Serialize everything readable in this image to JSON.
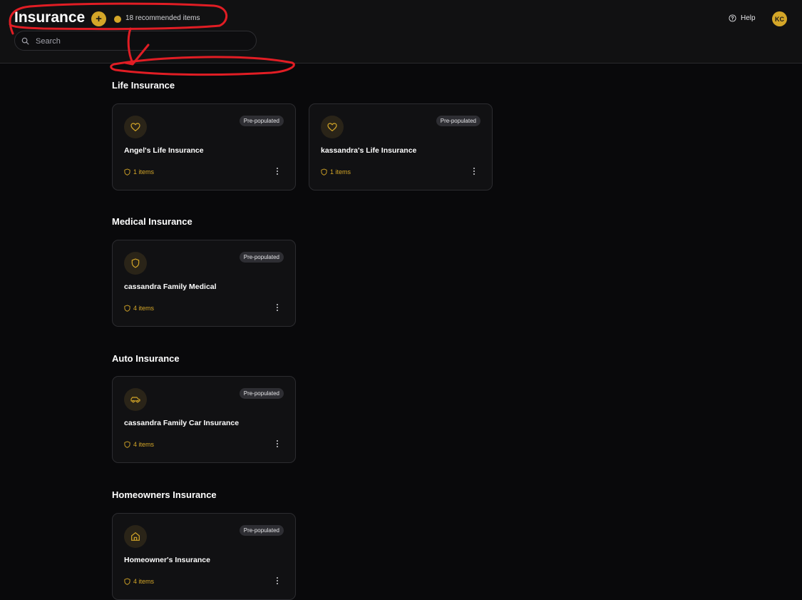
{
  "header": {
    "title": "Insurance",
    "add_label": "+",
    "recommended_label": "18 recommended items",
    "search_placeholder": "Search",
    "help_label": "Help",
    "avatar_initials": "KC"
  },
  "colors": {
    "accent": "#d4a628",
    "background": "#09090b",
    "card": "#111113",
    "annotation": "#e11d24"
  },
  "sections": [
    {
      "title": "Life Insurance",
      "cards": [
        {
          "icon": "heart-icon",
          "badge": "Pre-populated",
          "title": "Angel's Life Insurance",
          "count": "1 items"
        },
        {
          "icon": "heart-icon",
          "badge": "Pre-populated",
          "title": "kassandra's Life Insurance",
          "count": "1 items"
        }
      ]
    },
    {
      "title": "Medical Insurance",
      "cards": [
        {
          "icon": "shield-icon",
          "badge": "Pre-populated",
          "title": "cassandra Family Medical",
          "count": "4 items"
        }
      ]
    },
    {
      "title": "Auto Insurance",
      "cards": [
        {
          "icon": "car-icon",
          "badge": "Pre-populated",
          "title": "cassandra Family Car Insurance",
          "count": "4 items"
        }
      ]
    },
    {
      "title": "Homeowners Insurance",
      "cards": [
        {
          "icon": "home-icon",
          "badge": "Pre-populated",
          "title": "Homeowner's Insurance",
          "count": "4 items"
        }
      ]
    }
  ]
}
